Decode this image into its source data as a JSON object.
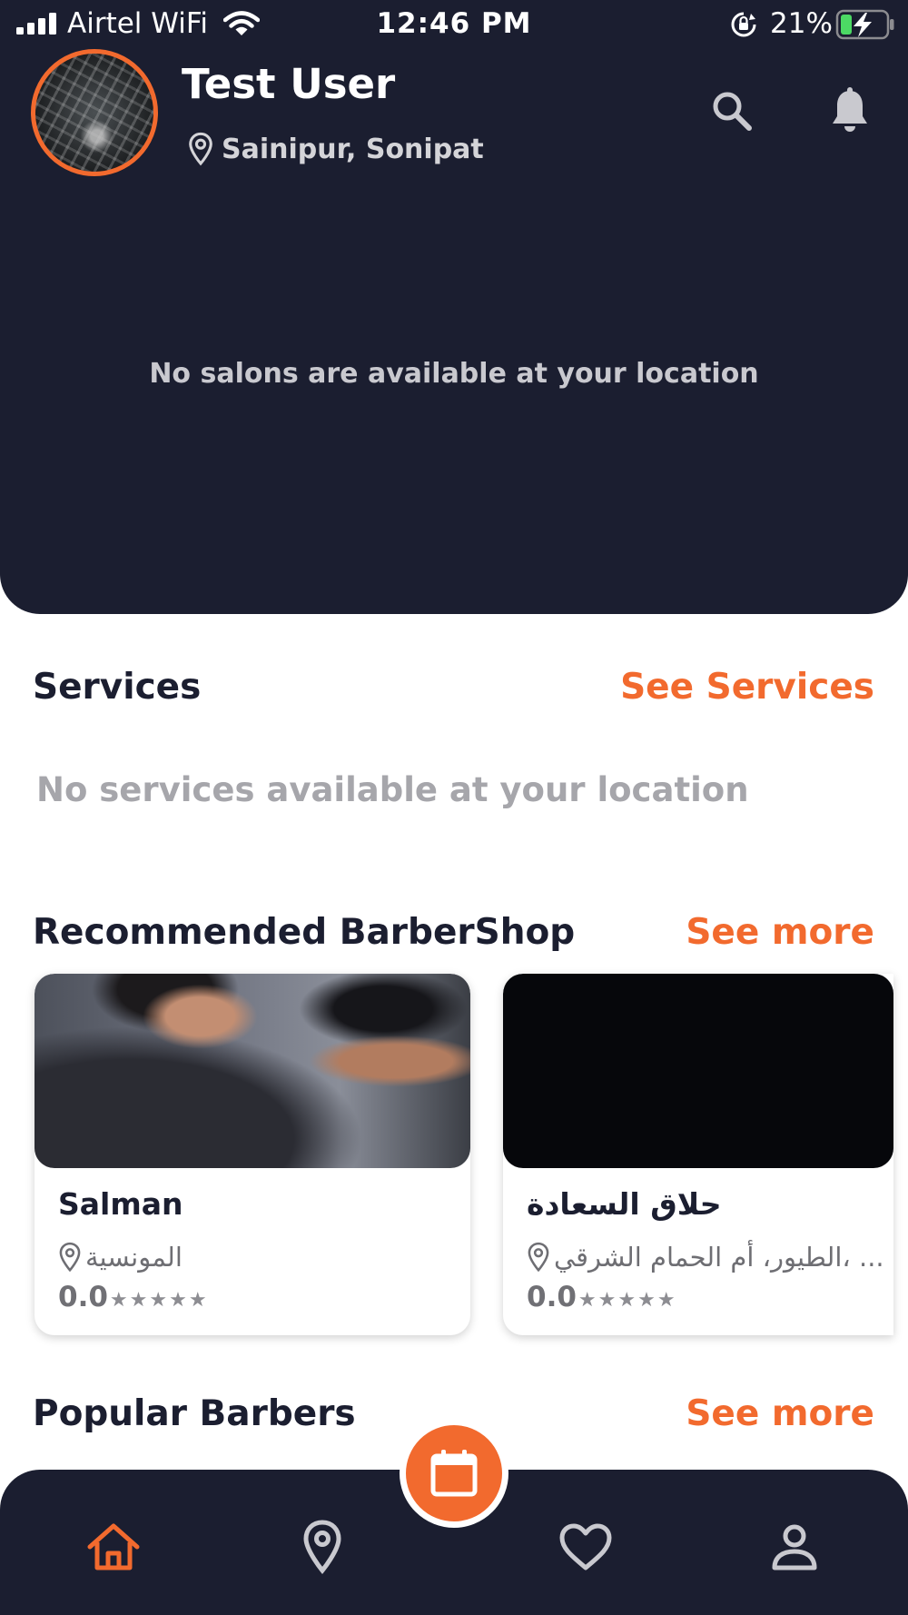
{
  "status_bar": {
    "carrier": "Airtel WiFi",
    "time": "12:46 PM",
    "battery_percent": "21%"
  },
  "header": {
    "user_name": "Test User",
    "location": "Sainipur, Sonipat",
    "empty_message": "No salons are available at your location"
  },
  "services": {
    "title": "Services",
    "link": "See Services",
    "empty_message": "No services available at your location"
  },
  "recommended": {
    "title": "Recommended BarberShop",
    "link": "See more",
    "cards": [
      {
        "name": "Salman",
        "address": "المونسية",
        "rating": "0.0",
        "stars": "★★★★★"
      },
      {
        "name": "حلاق السعادة",
        "address": "الطيور، أم الحمام الشرقي، ...",
        "rating": "0.0",
        "stars": "★★★★★"
      }
    ]
  },
  "popular": {
    "title": "Popular Barbers",
    "link": "See more"
  },
  "colors": {
    "dark": "#1b1e30",
    "accent": "#f26a2e",
    "muted_text": "#a6a6ab"
  },
  "icons": {
    "header": [
      "search-icon",
      "bell-icon",
      "location-pin-icon"
    ],
    "nav": [
      "home-icon",
      "map-pin-icon",
      "calendar-icon",
      "heart-icon",
      "person-icon"
    ]
  }
}
